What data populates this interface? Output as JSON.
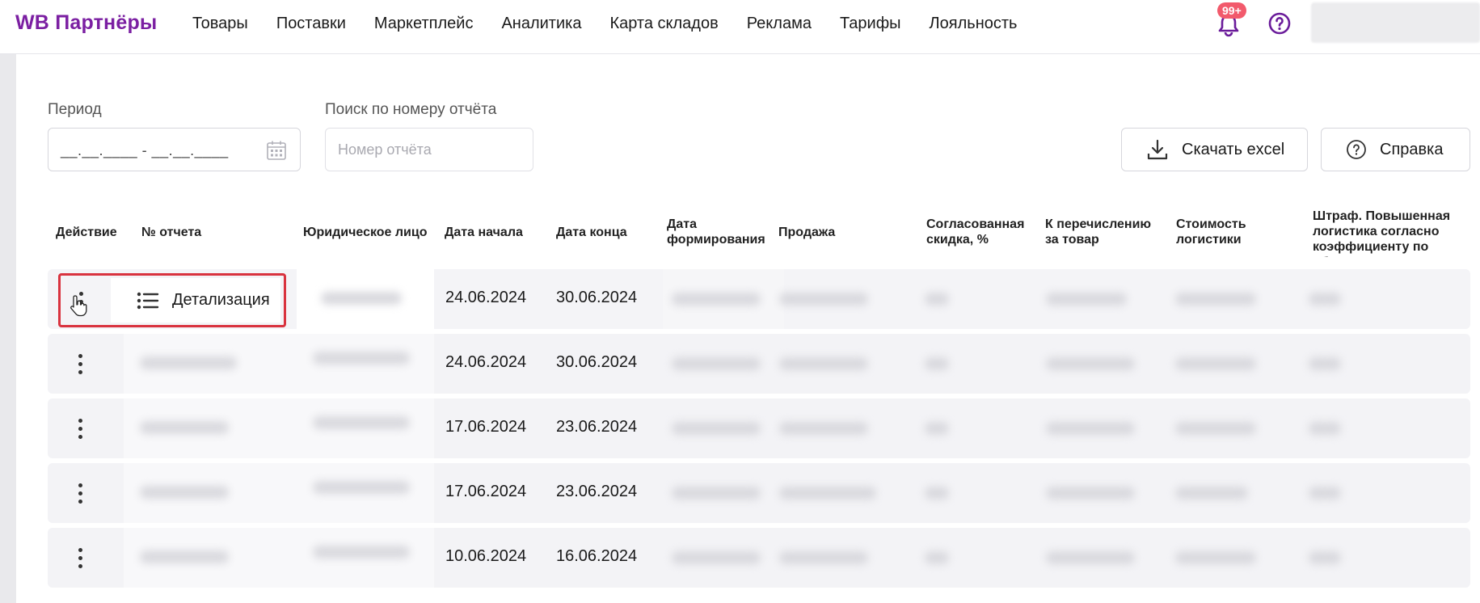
{
  "brand": {
    "logo": "WB Партнёры",
    "accent": "#7b1fa2"
  },
  "nav": [
    "Товары",
    "Поставки",
    "Маркетплейс",
    "Аналитика",
    "Карта складов",
    "Реклама",
    "Тарифы",
    "Лояльность"
  ],
  "notifications": {
    "badge": "99+",
    "badge_color": "#f25a6c",
    "icon": "bell-icon"
  },
  "filters": {
    "period_label": "Период",
    "period_value": "__.__.____ - __.__.____",
    "search_label": "Поиск по номеру отчёта",
    "search_placeholder": "Номер отчёта"
  },
  "actions": {
    "excel": "Скачать excel",
    "help": "Справка"
  },
  "table": {
    "columns": [
      "Действие",
      "№ отчета",
      "Юридическое лицо",
      "Дата начала",
      "Дата конца",
      "Дата формирования",
      "Продажа",
      "Согласованная скидка, %",
      "К перечислению за товар",
      "Стоимость логистики",
      "Штраф. Повышенная логистика согласно коэффициенту по обмерам"
    ],
    "rows": [
      {
        "start": "24.06.2024",
        "end": "30.06.2024"
      },
      {
        "start": "24.06.2024",
        "end": "30.06.2024"
      },
      {
        "start": "17.06.2024",
        "end": "23.06.2024"
      },
      {
        "start": "17.06.2024",
        "end": "23.06.2024"
      },
      {
        "start": "10.06.2024",
        "end": "16.06.2024"
      }
    ]
  },
  "menu": {
    "detail": "Детализация",
    "highlight_color": "#d9333f"
  }
}
